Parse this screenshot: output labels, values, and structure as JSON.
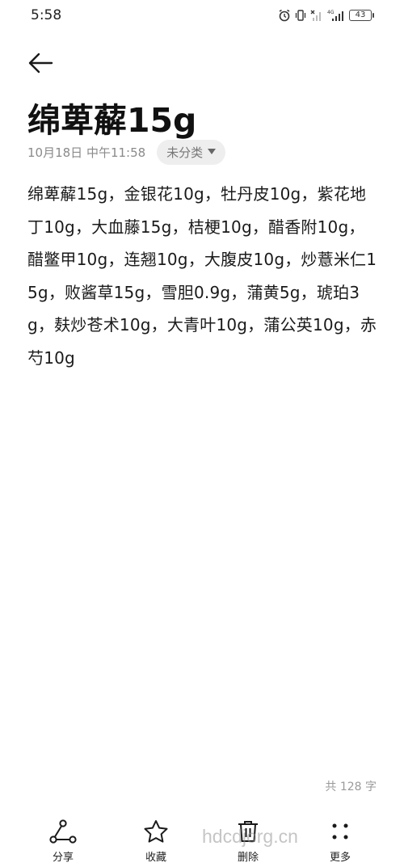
{
  "status_bar": {
    "time": "5:58",
    "battery": "43",
    "network_label": "4G"
  },
  "note": {
    "title": "绵萆薢15g",
    "date": "10月18日 中午11:58",
    "category": "未分类",
    "body": "绵萆薢15g，金银花10g，牡丹皮10g，紫花地丁10g，大血藤15g，桔梗10g，醋香附10g，醋鳖甲10g，连翘10g，大腹皮10g，炒薏米仁15g，败酱草15g，雪胆0.9g，蒲黄5g，琥珀3g，麸炒苍术10g，大青叶10g，蒲公英10g，赤芍10g",
    "word_count": "共 128 字"
  },
  "toolbar": {
    "share_label": "分享",
    "favorite_label": "收藏",
    "delete_label": "删除",
    "more_label": "更多"
  },
  "watermark": "hdcdjorg.cn",
  "icons": {
    "back": "arrow-left-icon",
    "share": "share-icon",
    "favorite": "star-icon",
    "delete": "trash-icon",
    "more": "more-dots-icon",
    "dropdown": "caret-down-icon"
  }
}
